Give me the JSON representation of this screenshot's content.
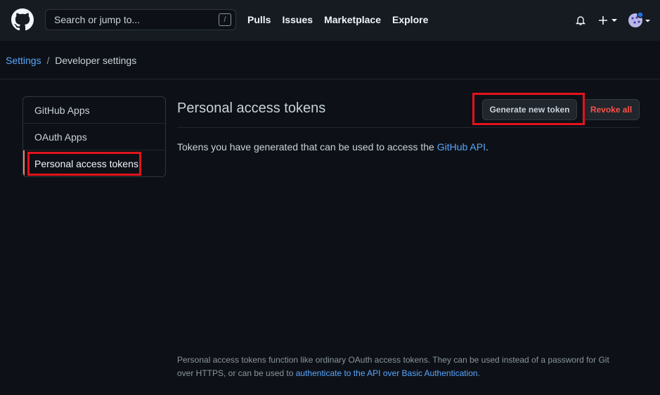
{
  "header": {
    "search_placeholder": "Search or jump to...",
    "search_key": "/",
    "nav": [
      "Pulls",
      "Issues",
      "Marketplace",
      "Explore"
    ]
  },
  "breadcrumb": {
    "parent": "Settings",
    "separator": "/",
    "current": "Developer settings"
  },
  "sidebar": {
    "items": [
      {
        "label": "GitHub Apps"
      },
      {
        "label": "OAuth Apps"
      },
      {
        "label": "Personal access tokens"
      }
    ]
  },
  "main": {
    "title": "Personal access tokens",
    "generate_label": "Generate new token",
    "revoke_label": "Revoke all",
    "desc_prefix": "Tokens you have generated that can be used to access the ",
    "desc_link": "GitHub API",
    "desc_suffix": "."
  },
  "footer": {
    "text": "Personal access tokens function like ordinary OAuth access tokens. They can be used instead of a password for Git over HTTPS, or can be used to ",
    "link": "authenticate to the API over Basic Authentication",
    "suffix": "."
  },
  "colors": {
    "accent_link": "#58a6ff",
    "danger": "#f85149",
    "highlight": "#e3131c",
    "selected_bar": "#f78166"
  }
}
